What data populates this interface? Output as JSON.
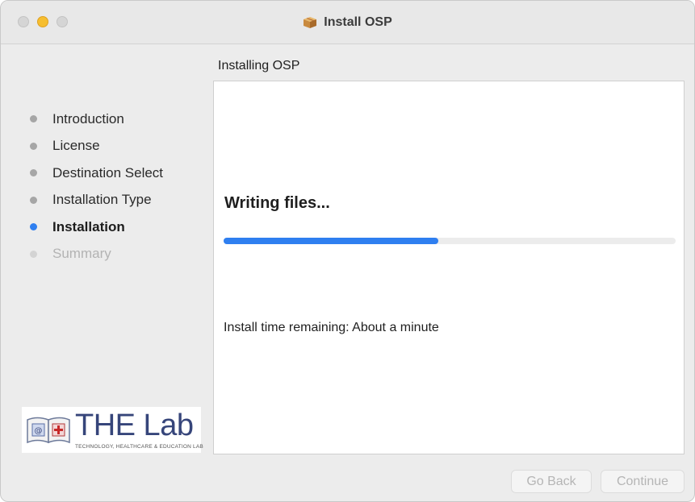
{
  "window": {
    "title": "Install OSP",
    "title_icon": "package-icon"
  },
  "subtitle": "Installing OSP",
  "steps": [
    {
      "label": "Introduction",
      "state": "done"
    },
    {
      "label": "License",
      "state": "done"
    },
    {
      "label": "Destination Select",
      "state": "done"
    },
    {
      "label": "Installation Type",
      "state": "done"
    },
    {
      "label": "Installation",
      "state": "active"
    },
    {
      "label": "Summary",
      "state": "future"
    }
  ],
  "logo": {
    "name": "THE Lab",
    "tagline": "TECHNOLOGY, HEALTHCARE & EDUCATION LAB"
  },
  "main": {
    "status": "Writing files...",
    "progress": 0.475,
    "remaining": "Install time remaining: About a minute"
  },
  "buttons": {
    "back": "Go Back",
    "continue": "Continue"
  },
  "colors": {
    "accent": "#2f7ff0",
    "minimize": "#f6be2f"
  }
}
